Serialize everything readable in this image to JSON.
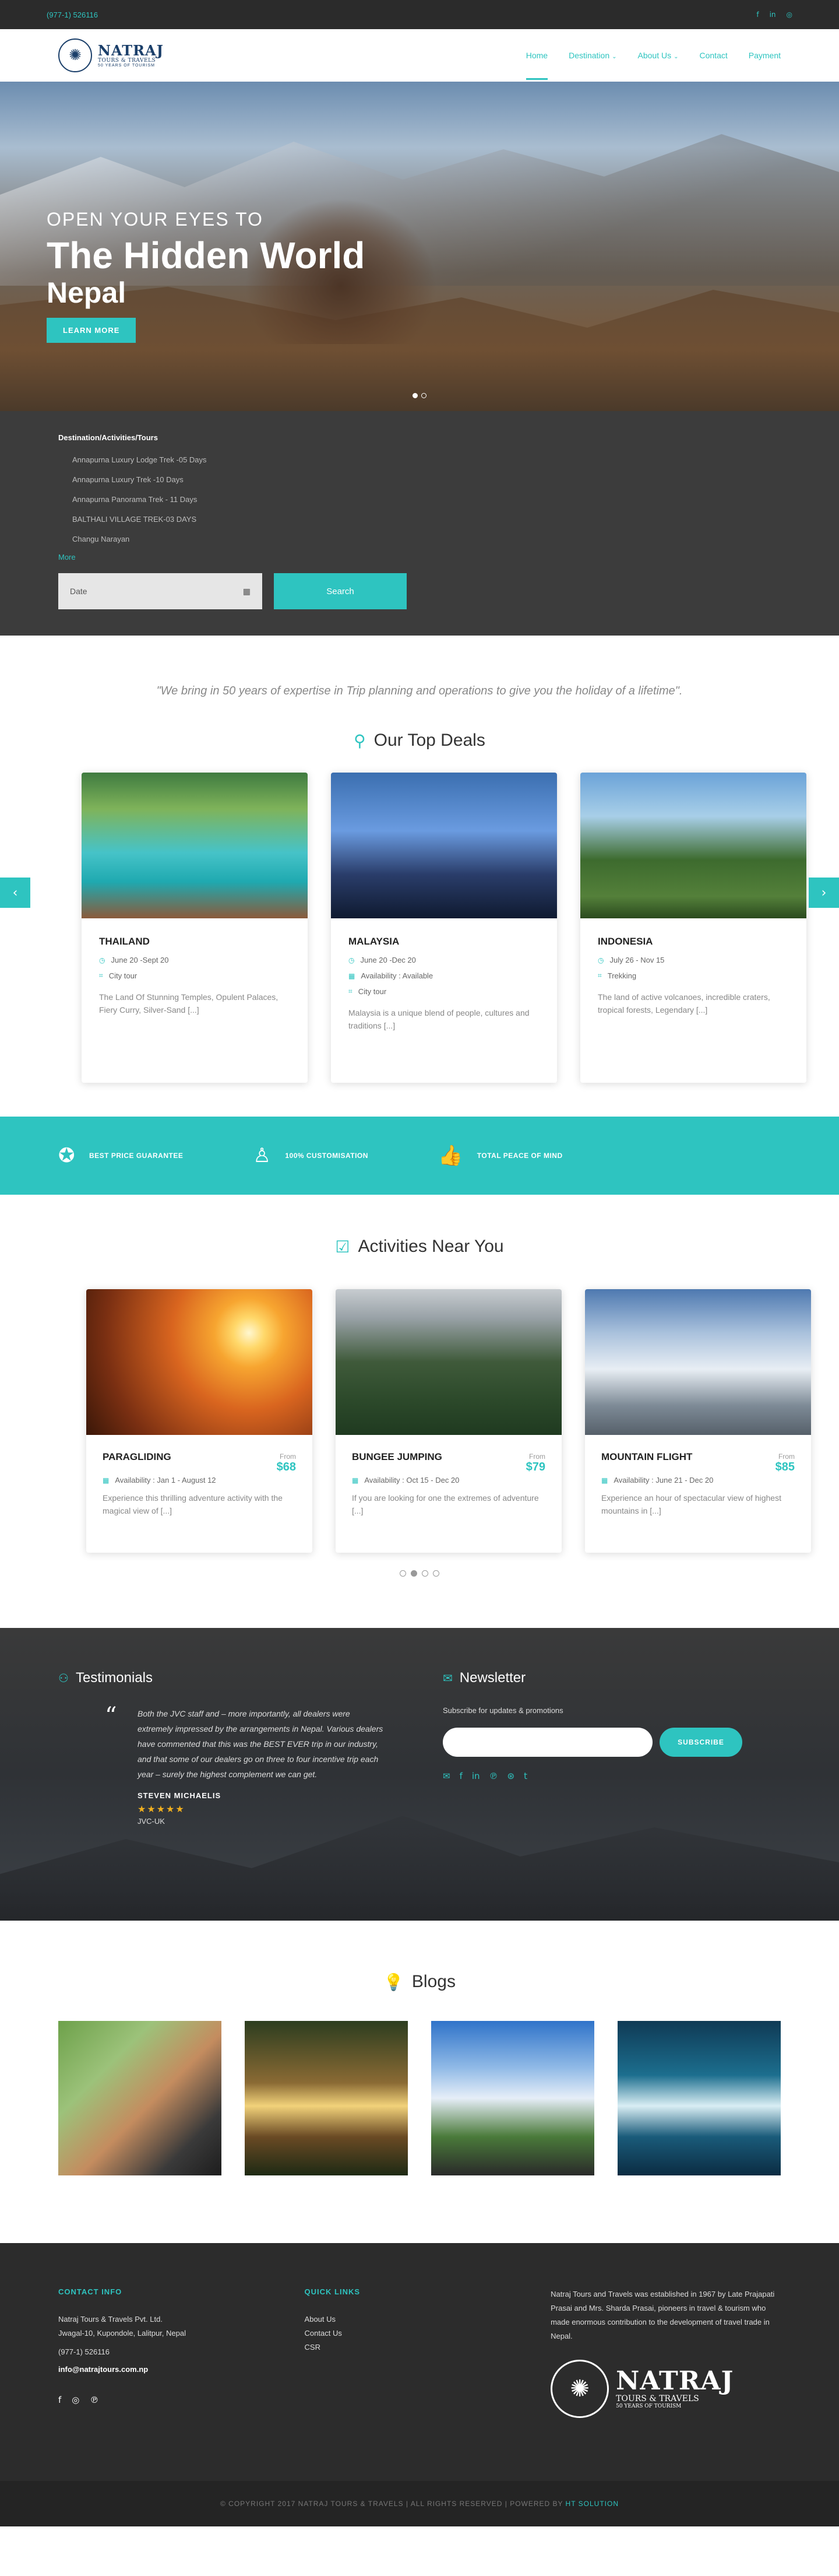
{
  "topbar": {
    "phone": "(977-1) 526116",
    "social": [
      "f",
      "in",
      "◎"
    ]
  },
  "header": {
    "logo_name": "NATRAJ",
    "logo_sub": "TOURS & TRAVELS",
    "logo_sub2": "50 YEARS OF TOURISM",
    "nav": [
      {
        "label": "Home"
      },
      {
        "label": "Destination"
      },
      {
        "label": "About Us"
      },
      {
        "label": "Contact"
      },
      {
        "label": "Payment"
      }
    ]
  },
  "hero": {
    "eyebrow": "OPEN YOUR EYES TO",
    "title": "The Hidden World",
    "subtitle": "Nepal",
    "button": "LEARN MORE"
  },
  "destination": {
    "heading": "Destination/Activities/Tours",
    "items": [
      "Annapurna Luxury Lodge Trek -05 Days",
      "Annapurna Luxury Trek -10 Days",
      "Annapurna Panorama Trek - 11 Days",
      "BALTHALI VILLAGE TREK-03 DAYS",
      "Changu Narayan"
    ],
    "more": "More",
    "date_placeholder": "Date",
    "search": "Search"
  },
  "quote": "\"We bring in 50 years of expertise in Trip planning and operations to give you the holiday of a lifetime\".",
  "top_deals": {
    "title": "Our Top Deals",
    "cards": [
      {
        "name": "THAILAND",
        "dates": "June 20 -Sept 20",
        "availability": "",
        "type": "City tour",
        "desc": "The Land Of Stunning Temples, Opulent Palaces, Fiery Curry, Silver-Sand [...]"
      },
      {
        "name": "MALAYSIA",
        "dates": "June 20 -Dec 20",
        "availability": "Availability : Available",
        "type": "City tour",
        "desc": "Malaysia is a unique blend of people, cultures and traditions [...]"
      },
      {
        "name": "INDONESIA",
        "dates": "July 26 - Nov 15",
        "availability": "",
        "type": "Trekking",
        "desc": "The land of active volcanoes, incredible craters, tropical forests, Legendary [...]"
      }
    ]
  },
  "features": [
    {
      "label": "BEST PRICE GUARANTEE"
    },
    {
      "label": "100% CUSTOMISATION"
    },
    {
      "label": "TOTAL PEACE OF MIND"
    }
  ],
  "activities": {
    "title": "Activities Near You",
    "cards": [
      {
        "name": "PARAGLIDING",
        "from": "From",
        "price": "$68",
        "availability": "Availability : Jan 1 - August 12",
        "desc": "Experience this thrilling adventure activity with the magical view of [...]"
      },
      {
        "name": "BUNGEE JUMPING",
        "from": "From",
        "price": "$79",
        "availability": "Availability : Oct 15 - Dec 20",
        "desc": "If you are looking for one the extremes of adventure [...]"
      },
      {
        "name": "MOUNTAIN FLIGHT",
        "from": "From",
        "price": "$85",
        "availability": "Availability : June 21 - Dec 20",
        "desc": "Experience an hour of spectacular view of highest mountains in [...]"
      }
    ]
  },
  "testimonials": {
    "title": "Testimonials",
    "text": "Both the JVC staff and – more importantly, all dealers were extremely impressed by the arrangements in Nepal. Various dealers have commented that this was the BEST EVER trip in our industry, and that some of our dealers go on three to four incentive trip each year – surely the highest complement we can get.",
    "name": "STEVEN MICHAELIS",
    "stars": "★★★★★",
    "org": "JVC-UK"
  },
  "newsletter": {
    "title": "Newsletter",
    "subtitle": "Subscribe for updates & promotions",
    "button": "SUBSCRIBE",
    "social": [
      "✉",
      "f",
      "in",
      "℗",
      "⊛",
      "t"
    ]
  },
  "blogs": {
    "title": "Blogs"
  },
  "footer": {
    "contact_head": "CONTACT INFO",
    "company": "Natraj Tours & Travels Pvt. Ltd.",
    "address": "Jwagal-10, Kupondole, Lalitpur, Nepal",
    "phone": "(977-1) 526116",
    "email": "info@natrajtours.com.np",
    "social": [
      "f",
      "◎",
      "℗"
    ],
    "quick_head": "QUICK LINKS",
    "links": [
      "About Us",
      "Contact Us",
      "CSR"
    ],
    "about": "Natraj Tours and Travels was established in 1967 by Late Prajapati Prasai and Mrs. Sharda Prasai, pioneers in travel & tourism who made enormous contribution to the development of travel trade in Nepal.",
    "logo_name": "NATRAJ",
    "logo_sub": "TOURS & TRAVELS",
    "logo_sub2": "50 YEARS OF TOURISM"
  },
  "copyright": {
    "text": "© COPYRIGHT 2017 NATRAJ TOURS & TRAVELS | ALL RIGHTS RESERVED | POWERED BY",
    "brand": "HT SOLUTION"
  },
  "colors": {
    "accent": "#2ec4c0",
    "dark": "#2b2b2b",
    "panel": "#3c3c3c"
  },
  "icons": {
    "pin": "⚲",
    "calendar": "▦",
    "tag": "⌗",
    "clock": "◷",
    "user": "⚇",
    "mail": "✉",
    "bulb": "⚲"
  }
}
